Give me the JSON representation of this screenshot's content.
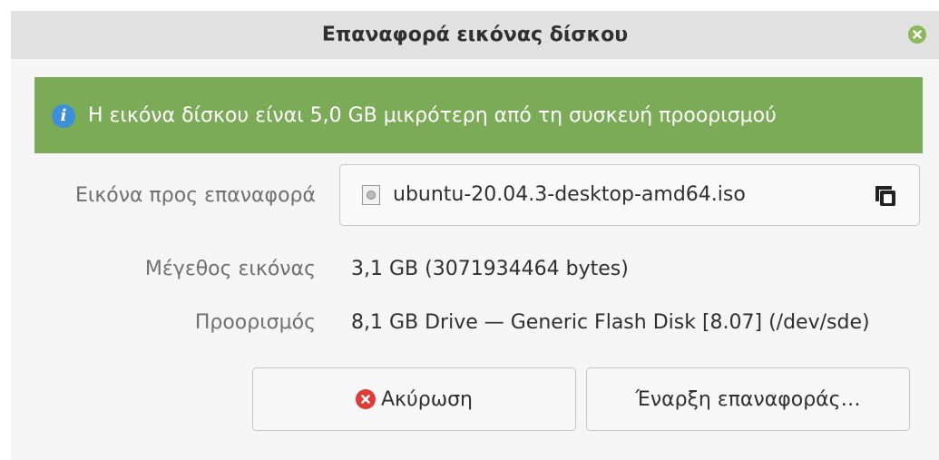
{
  "window": {
    "title": "Επαναφορά εικόνας δίσκου",
    "close_icon": "close-icon"
  },
  "info": {
    "icon": "info-icon",
    "message": "Η εικόνα δίσκου είναι 5,0 GB μικρότερη από τη συσκευή προορισμού",
    "background_color": "#7bab57"
  },
  "form": {
    "image_label": "Εικόνα προς επαναφορά",
    "image_file": "ubuntu-20.04.3-desktop-amd64.iso",
    "image_file_icon": "disc-image-icon",
    "copy_icon": "copy-icon",
    "size_label": "Μέγεθος εικόνας",
    "size_value": "3,1 GB (3071934464 bytes)",
    "destination_label": "Προορισμός",
    "destination_value": "8,1 GB Drive — Generic Flash Disk [8.07] (/dev/sde)"
  },
  "buttons": {
    "cancel_label": "Ακύρωση",
    "cancel_icon": "cancel-icon",
    "start_label": "Έναρξη επαναφοράς…"
  }
}
